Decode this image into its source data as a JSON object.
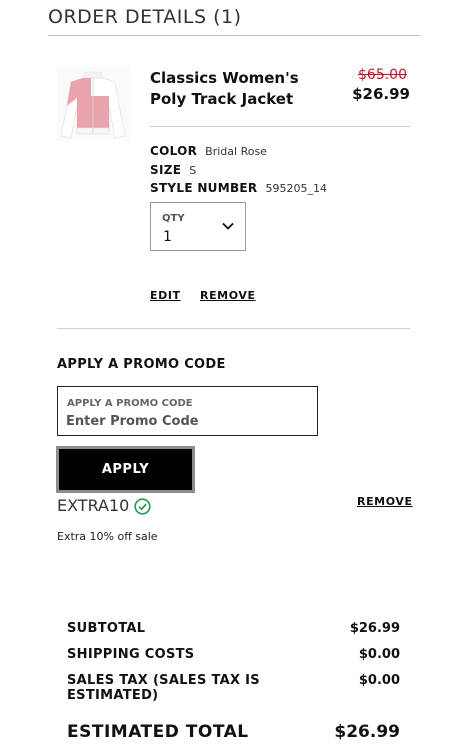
{
  "header": {
    "title": "ORDER DETAILS (1)"
  },
  "item": {
    "name": "Classics Women's Poly Track Jacket",
    "price_original": "$65.00",
    "price_sale": "$26.99",
    "attributes": [
      {
        "label": "COLOR",
        "value": "Bridal Rose"
      },
      {
        "label": "SIZE",
        "value": "S"
      },
      {
        "label": "STYLE NUMBER",
        "value": "595205_14"
      }
    ],
    "quantity": {
      "label": "QTY",
      "value": "1"
    },
    "edit_label": "EDIT",
    "remove_label": "REMOVE"
  },
  "promo": {
    "heading": "APPLY A PROMO CODE",
    "field_label": "APPLY A PROMO CODE",
    "placeholder": "Enter Promo Code",
    "apply_label": "APPLY",
    "applied_code": "EXTRA10",
    "applied_description": "Extra 10% off sale",
    "remove_label": "REMOVE"
  },
  "summary": {
    "rows": [
      {
        "label": "SUBTOTAL",
        "value": "$26.99"
      },
      {
        "label": "SHIPPING COSTS",
        "value": "$0.00"
      },
      {
        "label": "SALES TAX (SALES TAX IS ESTIMATED)",
        "value": "$0.00"
      }
    ],
    "total_label": "ESTIMATED TOTAL",
    "total_value": "$26.99"
  },
  "colors": {
    "sale_strike": "#c0182b",
    "check_green": "#1e9e4a",
    "jacket_pink": "#e9a3ad"
  },
  "icons": {
    "quantity": "chevron-down-icon",
    "applied": "check-circle-icon"
  }
}
